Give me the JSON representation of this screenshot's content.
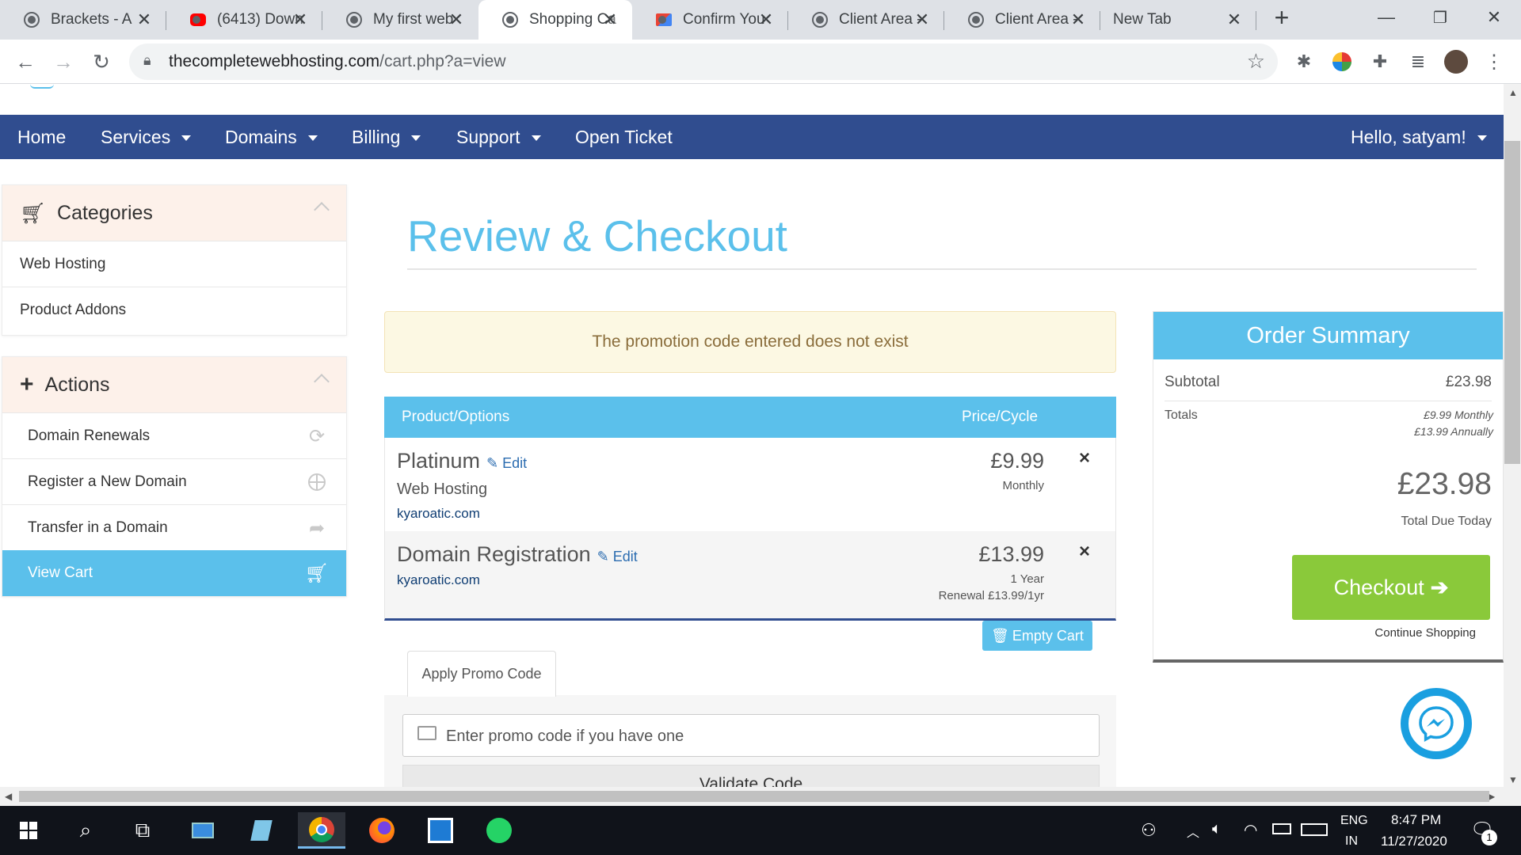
{
  "browser": {
    "tabs": [
      {
        "title": "Brackets - A",
        "active": false
      },
      {
        "title": "(6413) Down",
        "active": false
      },
      {
        "title": "My first web",
        "active": false
      },
      {
        "title": "Shopping Ca",
        "active": true
      },
      {
        "title": "Confirm You",
        "active": false
      },
      {
        "title": "Client Area -",
        "active": false
      },
      {
        "title": "Client Area -",
        "active": false
      },
      {
        "title": "New Tab",
        "active": false
      }
    ],
    "new_tab_icon": "+",
    "url_host": "thecompletewebhosting.com",
    "url_path": "/cart.php?a=view"
  },
  "nav": {
    "items": [
      "Home",
      "Services",
      "Domains",
      "Billing",
      "Support",
      "Open Ticket"
    ],
    "user": "Hello, satyam!"
  },
  "sidebar": {
    "categories_title": "Categories",
    "categories": [
      "Web Hosting",
      "Product Addons"
    ],
    "actions_title": "Actions",
    "actions": [
      "Domain Renewals",
      "Register a New Domain",
      "Transfer in a Domain",
      "View Cart"
    ]
  },
  "main": {
    "title": "Review & Checkout",
    "alert": "The promotion code entered does not exist",
    "col_product": "Product/Options",
    "col_price": "Price/Cycle",
    "items": [
      {
        "name": "Platinum",
        "edit": "Edit",
        "group": "Web Hosting",
        "domain": "kyaroatic.com",
        "price": "£9.99",
        "cycle": "Monthly",
        "renewal": ""
      },
      {
        "name": "Domain Registration",
        "edit": "Edit",
        "group": "",
        "domain": "kyaroatic.com",
        "price": "£13.99",
        "cycle": "1 Year",
        "renewal": "Renewal £13.99/1yr"
      }
    ],
    "remove_icon": "×",
    "empty_cart": "Empty Cart",
    "promo_tab": "Apply Promo Code",
    "promo_placeholder": "Enter promo code if you have one",
    "validate": "Validate Code"
  },
  "summary": {
    "title": "Order Summary",
    "subtotal_label": "Subtotal",
    "subtotal_value": "£23.98",
    "totals_label": "Totals",
    "totals_monthly": "£9.99 Monthly",
    "totals_annually": "£13.99 Annually",
    "total_due": "£23.98",
    "total_due_label": "Total Due Today",
    "checkout": "Checkout",
    "continue": "Continue Shopping"
  },
  "taskbar": {
    "lang1": "ENG",
    "lang2": "IN",
    "time": "8:47 PM",
    "date": "11/27/2020",
    "notif_count": "1"
  },
  "colors": {
    "nav": "#304d8f",
    "accent": "#5bc0eb",
    "checkout": "#8ac93a",
    "alert_bg": "#fcf8e3"
  }
}
